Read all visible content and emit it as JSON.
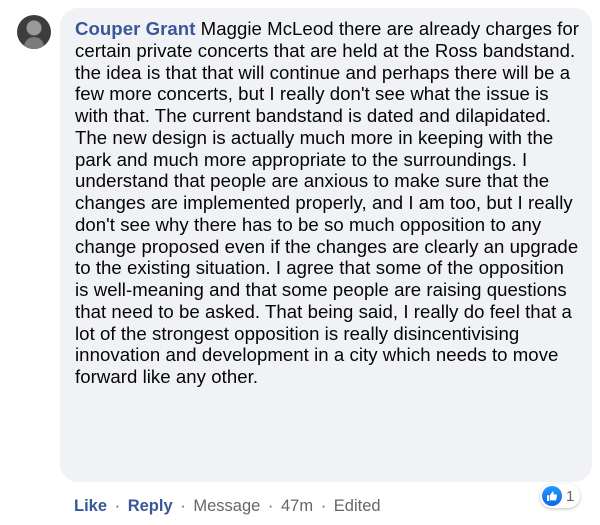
{
  "comment": {
    "author": "Couper Grant",
    "text": "Maggie McLeod there are already charges for certain private concerts that are held at the Ross bandstand. the idea is that that will continue and perhaps there will be a few more concerts, but I really don't see what the issue is with that. The current bandstand is dated and dilapidated. The new design is actually much more in keeping with the park and much more appropriate to the surroundings. I understand that people are anxious to make sure that the changes are implemented properly, and I am too, but I really don't see why there has to be so much opposition to any change proposed even if the changes are clearly an upgrade to the existing situation. I agree that some of the opposition is well-meaning and that some people are raising questions that need to be asked. That being said, I really do feel that a lot of the strongest opposition is really disincentivising innovation and development in a city which needs to move forward like any other."
  },
  "actions": {
    "like": "Like",
    "reply": "Reply",
    "message": "Message",
    "time": "47m",
    "edited": "Edited",
    "separator": "·"
  },
  "reactions": {
    "icon": "like-thumbs-up-icon",
    "count": "1",
    "color": "#1877f2"
  }
}
